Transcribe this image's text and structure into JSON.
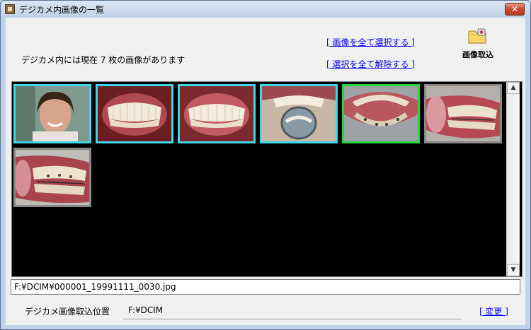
{
  "window": {
    "title": "デジカメ内画像の一覧",
    "close_label": "✕"
  },
  "header": {
    "select_all": "[ 画像を全て選択する ]",
    "deselect_all": "[ 選択を全て解除する ]",
    "count_text": "デジカメ内には現在 7 枚の画像があります",
    "import_label": "画像取込",
    "import_icon": "folder-import-icon"
  },
  "gallery": {
    "thumbnails": [
      {
        "name": "portrait",
        "state": "selected"
      },
      {
        "name": "frontal-teeth",
        "state": "selected"
      },
      {
        "name": "frontal-teeth-2",
        "state": "selected"
      },
      {
        "name": "upper-occlusal-mirror",
        "state": "selected"
      },
      {
        "name": "lower-occlusal",
        "state": "focused"
      },
      {
        "name": "lateral-teeth",
        "state": "normal"
      },
      {
        "name": "lateral-teeth-2",
        "state": "normal"
      }
    ]
  },
  "status": {
    "current_file": "F:¥DCIM¥000001_19991111_0030.jpg"
  },
  "location": {
    "label": "デジカメ画像取込位置",
    "value": "F:¥DCIM",
    "change_link": "[ 変更 ]"
  },
  "colors": {
    "selected_border": "#3fd6e6",
    "focused_border": "#26d63c",
    "normal_border": "#888888",
    "link": "#0000ee"
  }
}
